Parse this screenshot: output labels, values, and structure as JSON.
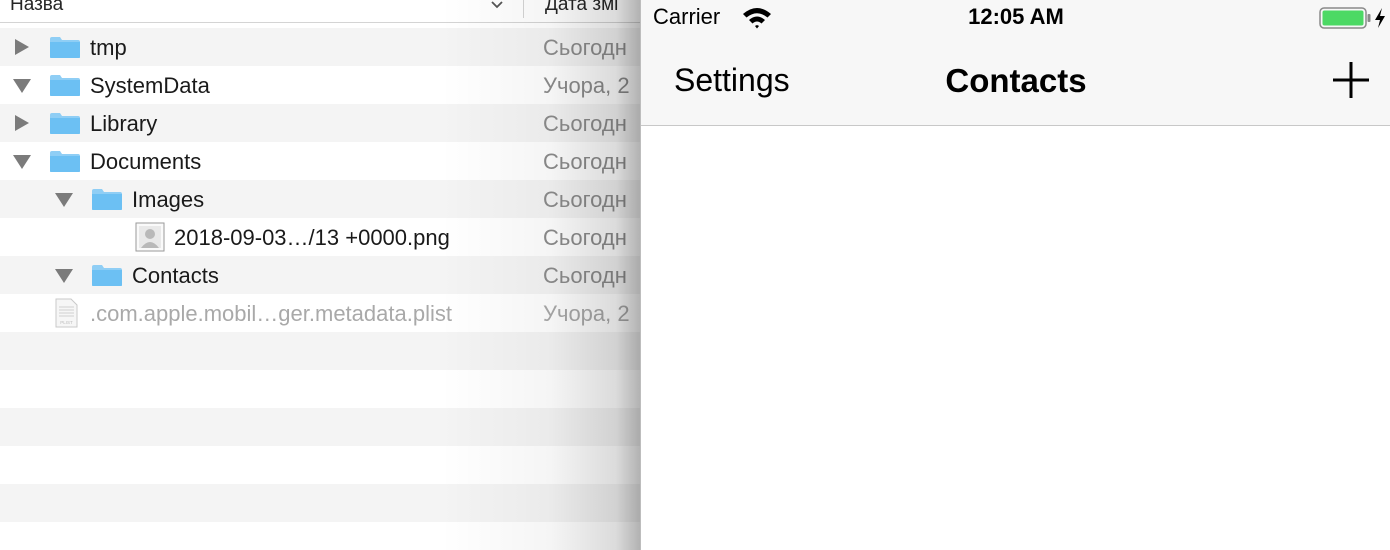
{
  "finder": {
    "columns": {
      "name": "Назва",
      "date": "Дата змі"
    },
    "rows": [
      {
        "label": "tmp",
        "date": "Сьогодн",
        "kind": "folder",
        "disclosure": "closed",
        "level": 0
      },
      {
        "label": "SystemData",
        "date": "Учора, 2",
        "kind": "folder",
        "disclosure": "open",
        "level": 0
      },
      {
        "label": "Library",
        "date": "Сьогодн",
        "kind": "folder",
        "disclosure": "closed",
        "level": 0
      },
      {
        "label": "Documents",
        "date": "Сьогодн",
        "kind": "folder",
        "disclosure": "open",
        "level": 0
      },
      {
        "label": "Images",
        "date": "Сьогодн",
        "kind": "folder",
        "disclosure": "open",
        "level": 1
      },
      {
        "label": "2018-09-03…/13 +0000.png",
        "date": "Сьогодн",
        "kind": "image-file",
        "disclosure": "none",
        "level": 2
      },
      {
        "label": "Contacts",
        "date": "Сьогодн",
        "kind": "folder",
        "disclosure": "open",
        "level": 1
      },
      {
        "label": ".com.apple.mobil…ger.metadata.plist",
        "date": "Учора, 2",
        "kind": "plist-file",
        "disclosure": "none",
        "level": 0
      }
    ]
  },
  "phone": {
    "status_bar": {
      "carrier": "Carrier",
      "time": "12:05 AM",
      "battery_color": "#4cd964"
    },
    "nav_bar": {
      "back_label": "Settings",
      "title": "Contacts",
      "add_icon": "plus-icon"
    }
  },
  "colors": {
    "folder_blue": "#6cc0f3",
    "row_alt": "#f4f4f4",
    "date_gray": "#8c8c8c"
  }
}
